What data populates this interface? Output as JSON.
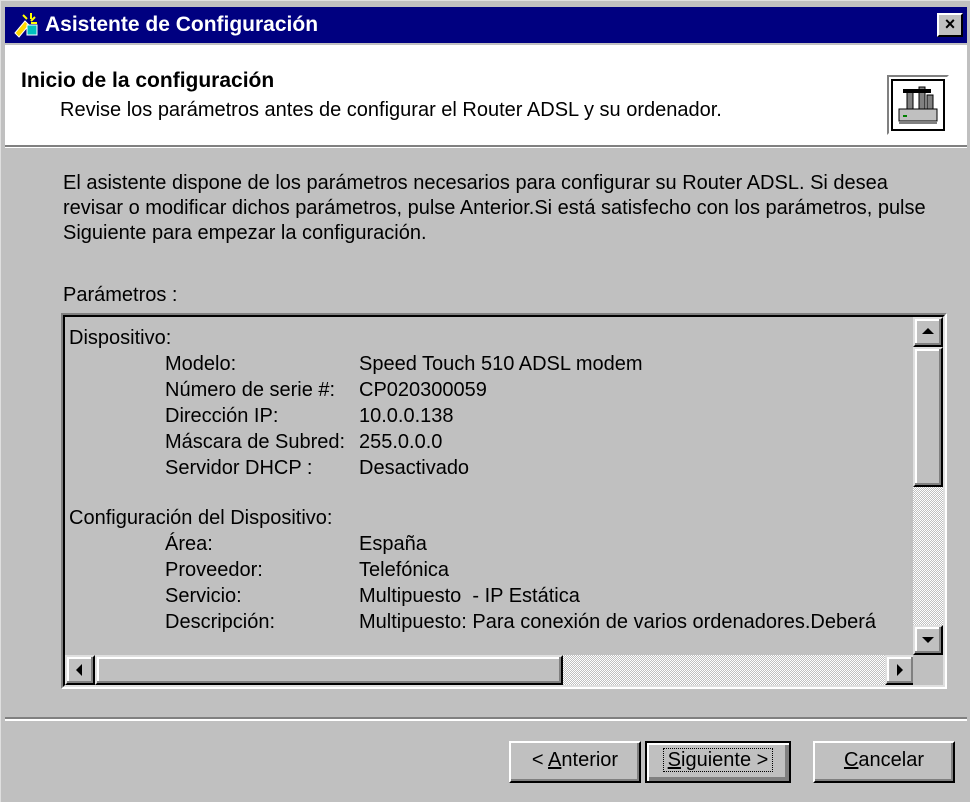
{
  "window": {
    "title": "Asistente de Configuración",
    "close_label": "×",
    "title_icon": "wizard-icon"
  },
  "header": {
    "title": "Inicio de la configuración",
    "subtitle": "Revise los parámetros antes de configurar el Router ADSL y su ordenador.",
    "icon": "router-icon"
  },
  "intro_text": "El asistente dispone de los parámetros necesarios para configurar su Router ADSL. Si desea revisar o modificar dichos parámetros, pulse Anterior.Si está satisfecho con los parámetros, pulse Siguiente para empezar la configuración.",
  "params_label": "Parámetros :",
  "params": {
    "device_title": "Dispositivo:",
    "device_rows": [
      {
        "key": "Modelo:",
        "value": "Speed Touch 510 ADSL modem"
      },
      {
        "key": "Número de serie #:",
        "value": "CP020300059"
      },
      {
        "key": "Dirección IP:",
        "value": "10.0.0.138"
      },
      {
        "key": "Máscara de Subred:",
        "value": "255.0.0.0"
      },
      {
        "key": "Servidor DHCP :",
        "value": "Desactivado"
      }
    ],
    "config_title": "Configuración del Dispositivo:",
    "config_rows": [
      {
        "key": "Área:",
        "value": "España"
      },
      {
        "key": "Proveedor:",
        "value": "Telefónica"
      },
      {
        "key": "Servicio:",
        "value": "Multipuesto  - IP Estática"
      },
      {
        "key": "Descripción:",
        "value": "Multipuesto: Para conexión de varios ordenadores.Deberá"
      }
    ]
  },
  "buttons": {
    "back_prefix": "< ",
    "back_accel": "A",
    "back_rest": "nterior",
    "next_accel": "S",
    "next_rest": "iguiente >",
    "cancel_accel": "C",
    "cancel_rest": "ancelar"
  }
}
